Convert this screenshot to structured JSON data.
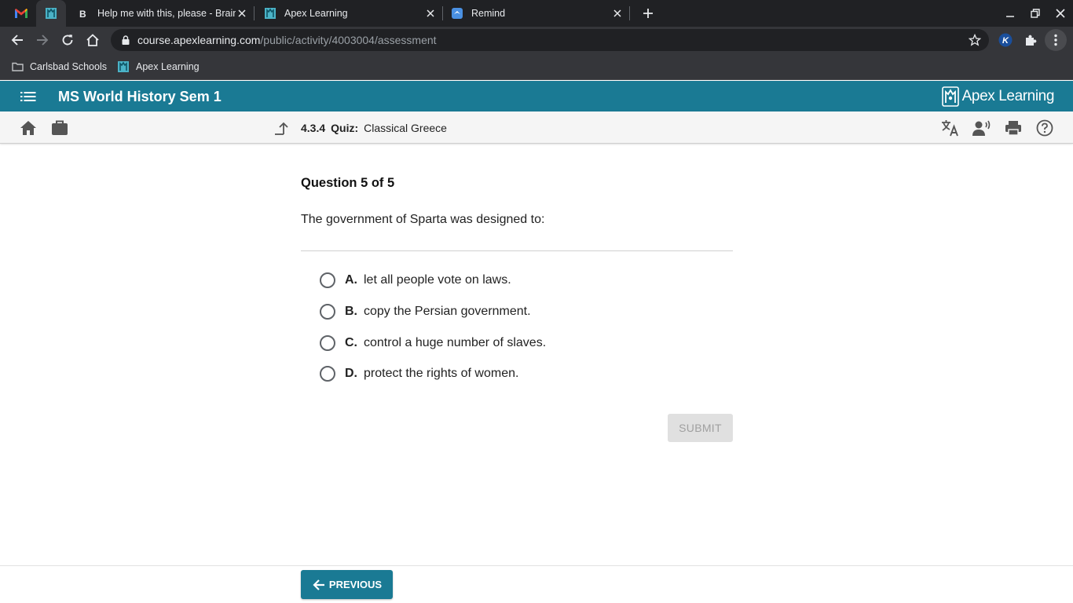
{
  "browser": {
    "tabs": [
      {
        "title": "Help me with this, please - Brainly",
        "favicon": "brainly-icon"
      },
      {
        "title": "Apex Learning",
        "favicon": "apex-icon"
      },
      {
        "title": "Remind",
        "favicon": "remind-icon"
      }
    ],
    "address": {
      "host": "course.apexlearning.com",
      "path": "/public/activity/4003004/assessment"
    },
    "bookmarks": [
      {
        "label": "Carlsbad Schools",
        "icon": "folder-icon"
      },
      {
        "label": "Apex Learning",
        "icon": "apex-icon"
      }
    ],
    "extension_badge": "K"
  },
  "header": {
    "course_title": "MS World History Sem 1",
    "brand": "Apex Learning"
  },
  "breadcrumb": {
    "number": "4.3.4",
    "kind": "Quiz:",
    "title": "Classical Greece"
  },
  "question": {
    "counter": "Question 5 of 5",
    "prompt": "The government of Sparta was designed to:",
    "options": [
      {
        "letter": "A.",
        "text": "let all people vote on laws."
      },
      {
        "letter": "B.",
        "text": "copy the Persian government."
      },
      {
        "letter": "C.",
        "text": "control a huge number of slaves."
      },
      {
        "letter": "D.",
        "text": "protect the rights of women."
      }
    ],
    "submit_label": "SUBMIT"
  },
  "footer": {
    "previous_label": "PREVIOUS"
  },
  "colors": {
    "brand_teal": "#1a7a94",
    "chrome_dark": "#202124",
    "chrome_toolbar": "#35363a"
  }
}
